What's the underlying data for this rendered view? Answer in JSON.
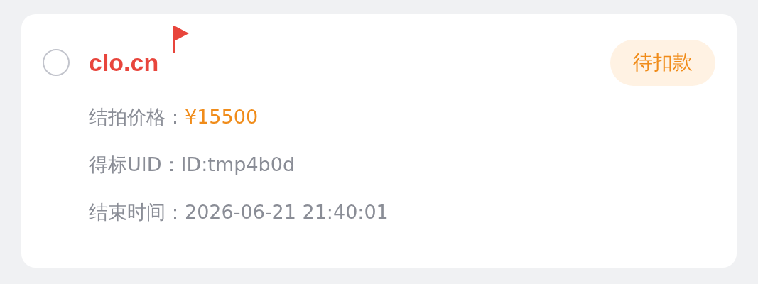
{
  "item": {
    "selected": false,
    "domain": "clo.cn",
    "flagged": true,
    "status": "待扣款",
    "details": [
      {
        "label": "结拍价格：",
        "value": "¥15500",
        "kind": "price"
      },
      {
        "label": "得标UID：",
        "value": "ID:tmp4b0d",
        "kind": "text"
      },
      {
        "label": "结束时间：",
        "value": "2026-06-21 21:40:01",
        "kind": "text"
      }
    ]
  }
}
